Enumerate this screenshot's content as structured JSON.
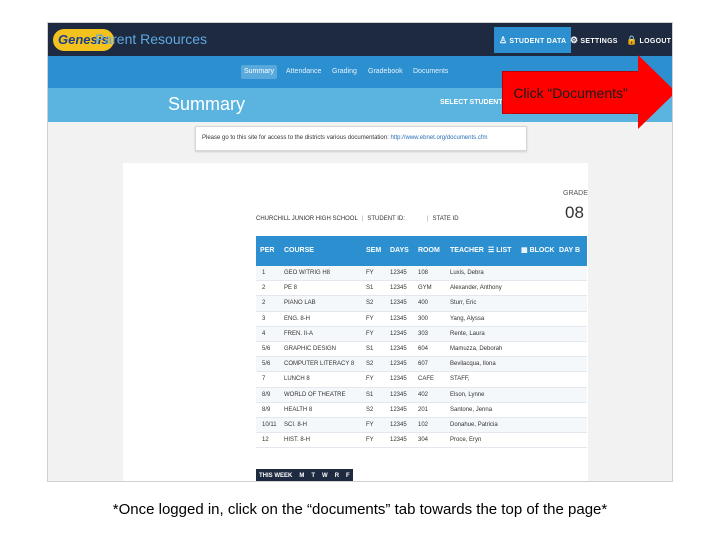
{
  "header": {
    "logo": "Genesis",
    "brand": "Parent Resources",
    "buttons": {
      "student_data": "STUDENT DATA",
      "settings": "SETTINGS",
      "logout": "LOGOUT"
    }
  },
  "nav": {
    "tabs": [
      {
        "label": "Summary",
        "active": true
      },
      {
        "label": "Attendance"
      },
      {
        "label": "Grading"
      },
      {
        "label": "Gradebook"
      },
      {
        "label": "Documents"
      }
    ]
  },
  "summary": {
    "title": "Summary",
    "select_label": "SELECT STUDENT:",
    "select_value": ""
  },
  "notice": {
    "text": "Please go to this site for access to the districts various documentation:",
    "link": "http://www.ebnet.org/documents.cfm"
  },
  "student": {
    "grade_label": "GRADE",
    "grade": "08",
    "school": "CHURCHILL JUNIOR HIGH SCHOOL",
    "student_id_label": "STUDENT ID:",
    "state_id_label": "STATE ID"
  },
  "schedule": {
    "headers": {
      "per": "PER",
      "course": "COURSE",
      "sem": "SEM",
      "days": "DAYS",
      "room": "ROOM",
      "teacher": "TEACHER",
      "list": "LIST",
      "block": "BLOCK",
      "day": "DAY B"
    },
    "rows": [
      {
        "per": "1",
        "course": "GEO W/TRIG H8",
        "sem": "FY",
        "days": "12345",
        "room": "108",
        "teacher": "Luxis, Debra"
      },
      {
        "per": "2",
        "course": "PE 8",
        "sem": "S1",
        "days": "12345",
        "room": "GYM",
        "teacher": "Alexander, Anthony"
      },
      {
        "per": "2",
        "course": "PIANO LAB",
        "sem": "S2",
        "days": "12345",
        "room": "400",
        "teacher": "Sturr, Eric"
      },
      {
        "per": "3",
        "course": "ENG. 8-H",
        "sem": "FY",
        "days": "12345",
        "room": "300",
        "teacher": "Yang, Alyssa"
      },
      {
        "per": "4",
        "course": "FREN. II-A",
        "sem": "FY",
        "days": "12345",
        "room": "303",
        "teacher": "Rente, Laura"
      },
      {
        "per": "5/6",
        "course": "GRAPHIC DESIGN",
        "sem": "S1",
        "days": "12345",
        "room": "604",
        "teacher": "Mamuzza, Deborah"
      },
      {
        "per": "5/6",
        "course": "COMPUTER LITERACY 8",
        "sem": "S2",
        "days": "12345",
        "room": "607",
        "teacher": "Bevilacqua, Ilona"
      },
      {
        "per": "7",
        "course": "LUNCH 8",
        "sem": "FY",
        "days": "12345",
        "room": "CAFE",
        "teacher": "STAFF,"
      },
      {
        "per": "8/9",
        "course": "WORLD OF THEATRE",
        "sem": "S1",
        "days": "12345",
        "room": "402",
        "teacher": "Elson, Lynne"
      },
      {
        "per": "8/9",
        "course": "HEALTH 8",
        "sem": "S2",
        "days": "12345",
        "room": "201",
        "teacher": "Santone, Jenna"
      },
      {
        "per": "10/11",
        "course": "SCI. 8-H",
        "sem": "FY",
        "days": "12345",
        "room": "102",
        "teacher": "Donahue, Patricia"
      },
      {
        "per": "12",
        "course": "HIST. 8-H",
        "sem": "FY",
        "days": "12345",
        "room": "304",
        "teacher": "Proce, Eryn"
      }
    ]
  },
  "week": {
    "label": "THIS WEEK",
    "days": [
      "M",
      "T",
      "W",
      "R",
      "F"
    ]
  },
  "callout": {
    "text": "Click “Documents”",
    "color": "#ff0000"
  },
  "caption": "*Once logged in, click on the “documents” tab towards the top of the page*"
}
